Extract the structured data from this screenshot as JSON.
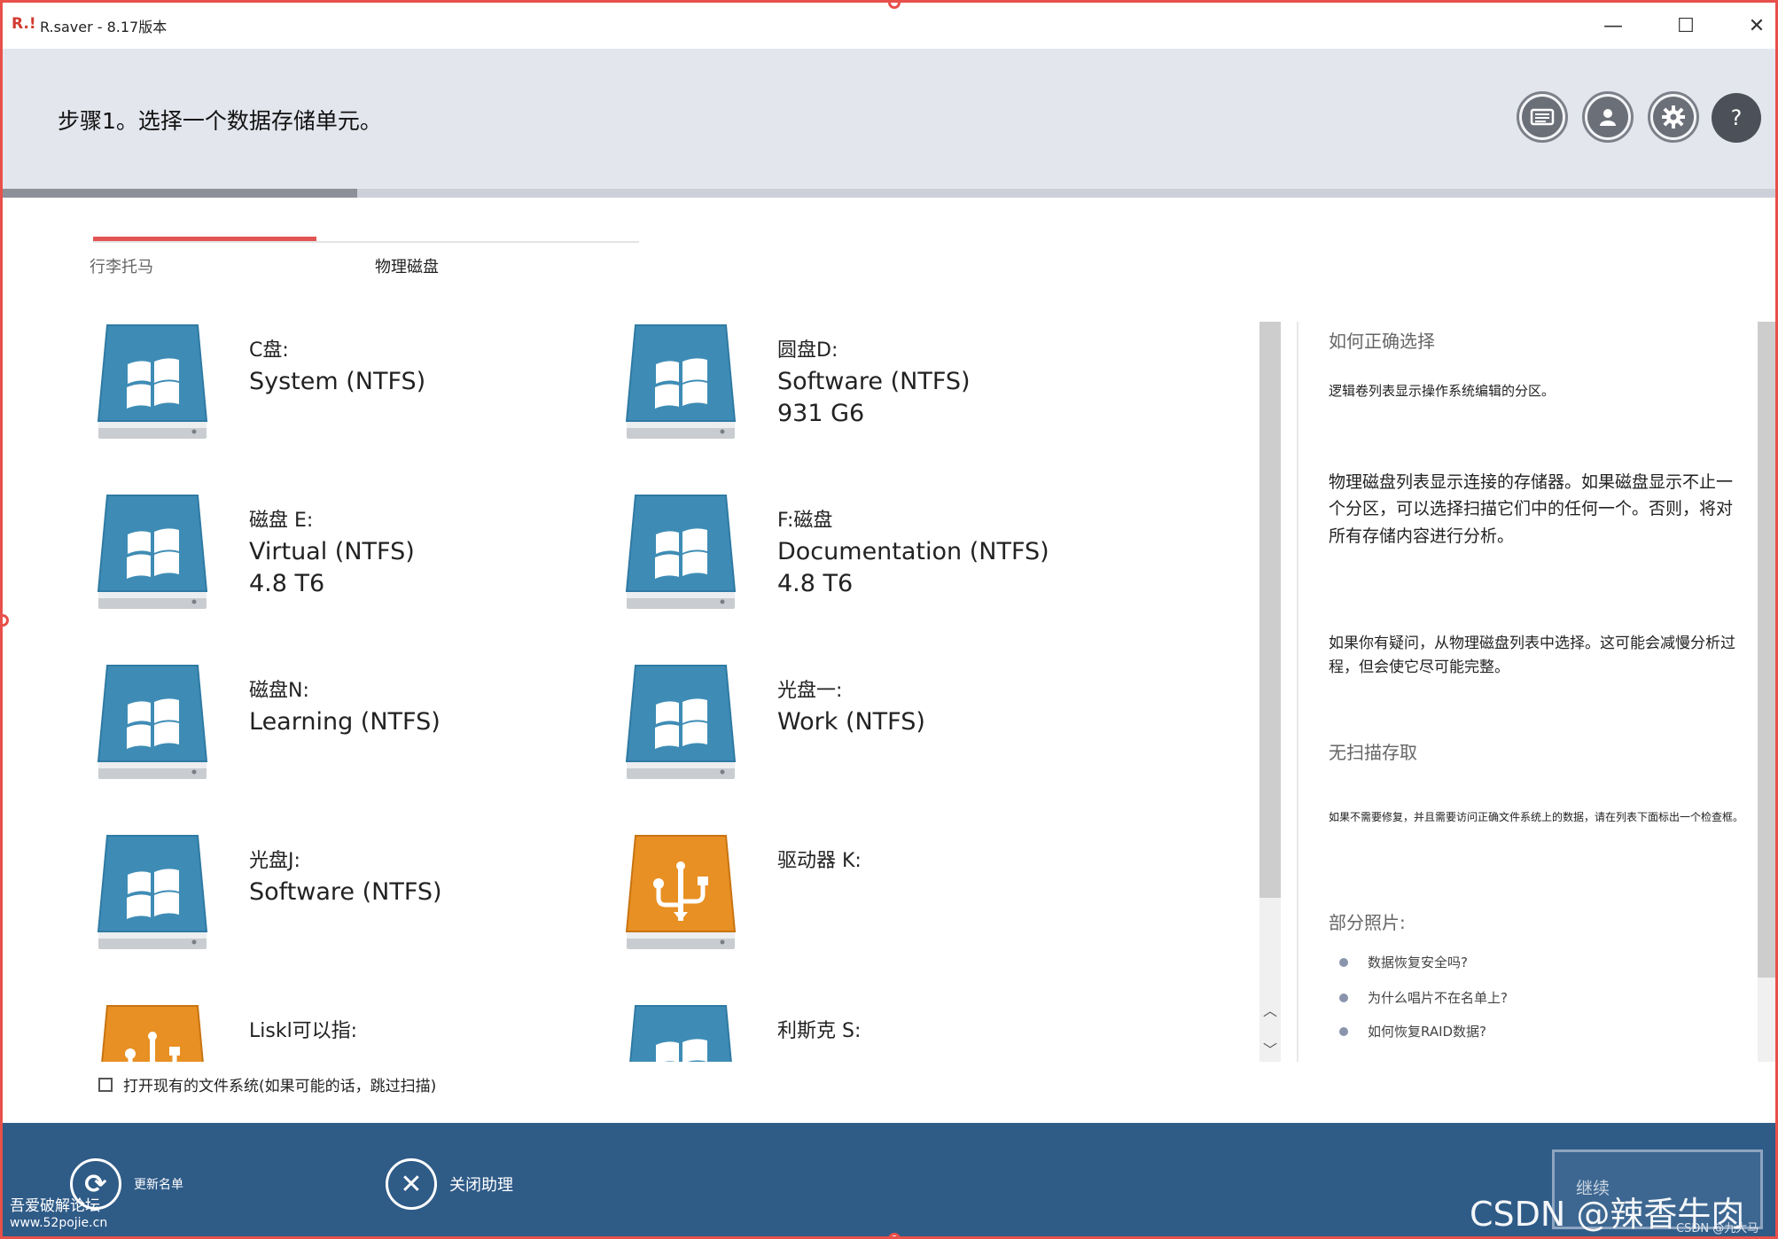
{
  "window": {
    "title": "R.saver - 8.17版本",
    "logo": "R.!",
    "controls": {
      "minimize": "—",
      "maximize": "☐",
      "close": "✕"
    }
  },
  "header": {
    "step_title": "步骤1。选择一个数据存储单元。",
    "icons": [
      "screen-icon",
      "user-icon",
      "gear-icon",
      "help-icon"
    ],
    "help_label": "?",
    "progress": 0.2
  },
  "tabs": [
    {
      "label": "行李托马",
      "active": true
    },
    {
      "label": "物理磁盘",
      "active": false
    }
  ],
  "drives": [
    {
      "name": "C盘:",
      "fs": "System (NTFS)",
      "size": "",
      "icon": "windows-drive-icon"
    },
    {
      "name": "圆盘D:",
      "fs": "Software (NTFS)",
      "size": "931 G6",
      "icon": "windows-drive-icon"
    },
    {
      "name": "磁盘 E:",
      "fs": "Virtual (NTFS)",
      "size": "4.8 T6",
      "icon": "windows-drive-icon"
    },
    {
      "name": "F:磁盘",
      "fs": "Documentation (NTFS)",
      "size": "4.8 T6",
      "icon": "windows-drive-icon"
    },
    {
      "name": "磁盘N:",
      "fs": "Learning (NTFS)",
      "size": "",
      "icon": "windows-drive-icon"
    },
    {
      "name": "光盘一:",
      "fs": "Work (NTFS)",
      "size": "",
      "icon": "windows-drive-icon"
    },
    {
      "name": "光盘J:",
      "fs": "Software (NTFS)",
      "size": "",
      "icon": "windows-drive-icon"
    },
    {
      "name": "驱动器 K:",
      "fs": "",
      "size": "",
      "icon": "usb-drive-icon"
    },
    {
      "name": "Liskl可以指:",
      "fs": "",
      "size": "",
      "icon": "usb-drive-icon"
    },
    {
      "name": "利斯克 S:",
      "fs": "",
      "size": "",
      "icon": "windows-drive-icon"
    }
  ],
  "checkbox": {
    "label": "打开现有的文件系统(如果可能的话，跳过扫描)",
    "checked": false
  },
  "help_panel": {
    "heading1": "如何正确选择",
    "para1": "逻辑卷列表显示操作系统编辑的分区。",
    "para2": "物理磁盘列表显示连接的存储器。如果磁盘显示不止一个分区，可以选择扫描它们中的任何一个。否则，将对所有存储内容进行分析。",
    "para3": "如果你有疑问，从物理磁盘列表中选择。这可能会减慢分析过程，但会使它尽可能完整。",
    "heading2": "无扫描存取",
    "para4": "如果不需要修复，并且需要访问正确文件系统上的数据，请在列表下面标出一个检查框。",
    "heading3": "部分照片:",
    "links": [
      "数据恢复安全吗?",
      "为什么唱片不在名单上?",
      "如何恢复RAID数据?"
    ]
  },
  "footer": {
    "refresh_label": "更新名单",
    "close_label": "关闭助理",
    "continue_label": "继续",
    "watermark_left_1": "吾爱破解论坛",
    "watermark_left_2": "www.52pojie.cn",
    "watermark_right": "CSDN @辣香牛肉面",
    "watermark_small": "CSDN @九大马"
  },
  "colors": {
    "accent_red": "#e25452",
    "footer_blue": "#2f5b87",
    "drive_blue": "#3e8cb5",
    "usb_orange": "#e89023"
  }
}
